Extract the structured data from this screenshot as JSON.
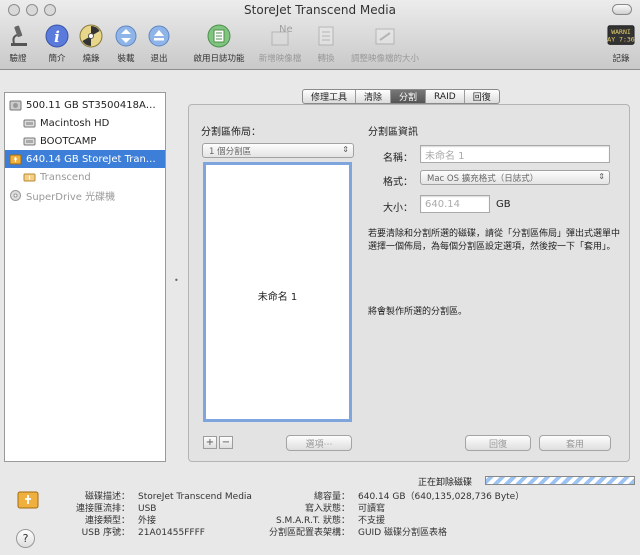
{
  "window": {
    "title": "StoreJet Transcend Media"
  },
  "toolbar": [
    {
      "name": "verify",
      "label": "驗證",
      "enabled": true
    },
    {
      "name": "info",
      "label": "簡介",
      "enabled": true
    },
    {
      "name": "burn",
      "label": "燒錄",
      "enabled": true
    },
    {
      "name": "mount",
      "label": "裝載",
      "enabled": true
    },
    {
      "name": "eject",
      "label": "退出",
      "enabled": true
    },
    {
      "name": "enable-journaling",
      "label": "啟用日誌功能",
      "enabled": true
    },
    {
      "name": "new-image",
      "label": "新增映像檔",
      "enabled": false
    },
    {
      "name": "convert",
      "label": "轉換",
      "enabled": false
    },
    {
      "name": "resize-image",
      "label": "調整映像檔的大小",
      "enabled": false
    },
    {
      "name": "log",
      "label": "記錄",
      "enabled": true,
      "badge_line1": "WARNI",
      "badge_line2": "AY 7:36"
    }
  ],
  "sidebar": {
    "items": [
      {
        "label": "500.11 GB ST3500418A…",
        "level": 0,
        "kind": "disk",
        "selected": false,
        "dim": false
      },
      {
        "label": "Macintosh HD",
        "level": 1,
        "kind": "volume",
        "selected": false,
        "dim": false
      },
      {
        "label": "BOOTCAMP",
        "level": 1,
        "kind": "volume",
        "selected": false,
        "dim": false
      },
      {
        "label": "640.14 GB StoreJet Tran…",
        "level": 0,
        "kind": "usb",
        "selected": true,
        "dim": false
      },
      {
        "label": "Transcend",
        "level": 1,
        "kind": "volume-usb",
        "selected": false,
        "dim": true
      },
      {
        "label": "SuperDrive 光碟機",
        "level": 0,
        "kind": "optical",
        "selected": false,
        "dim": true
      }
    ]
  },
  "tabs": [
    {
      "label": "修理工具",
      "active": false
    },
    {
      "label": "清除",
      "active": false
    },
    {
      "label": "分割",
      "active": true
    },
    {
      "label": "RAID",
      "active": false
    },
    {
      "label": "回復",
      "active": false
    }
  ],
  "partition": {
    "layout_title": "分割區佈局：",
    "layout_popup": "1 個分割區",
    "layout_partition_name": "未命名 1",
    "add": "+",
    "remove": "−",
    "options": "選項⋯",
    "info_title": "分割區資訊",
    "name_label": "名稱：",
    "name_value": "未命名 1",
    "format_label": "格式：",
    "format_value": "Mac OS 擴充格式（日誌式）",
    "size_label": "大小：",
    "size_value": "640.14",
    "size_unit": "GB",
    "help_text": "若要清除和分割所選的磁碟，請從「分割區佈局」彈出式選單中選擇一個佈局，為每個分割區設定選項，然後按一下「套用」。",
    "status_text": "將會製作所選的分割區。",
    "revert": "回復",
    "apply": "套用"
  },
  "status": {
    "unmounting": "正在卸除磁碟",
    "indeterminate": true
  },
  "info": {
    "left": [
      {
        "k": "磁碟描述：",
        "v": "StoreJet Transcend Media"
      },
      {
        "k": "連接匯流排：",
        "v": "USB"
      },
      {
        "k": "連接類型：",
        "v": "外接"
      },
      {
        "k": "USB 序號：",
        "v": "21A01455FFFF"
      }
    ],
    "right": [
      {
        "k": "總容量：",
        "v": "640.14 GB（640,135,028,736 Byte）"
      },
      {
        "k": "寫入狀態：",
        "v": "可讀寫"
      },
      {
        "k": "S.M.A.R.T. 狀態：",
        "v": "不支援"
      },
      {
        "k": "分割區配置表架構：",
        "v": "GUID 磁碟分割區表格"
      }
    ]
  },
  "help": "?"
}
